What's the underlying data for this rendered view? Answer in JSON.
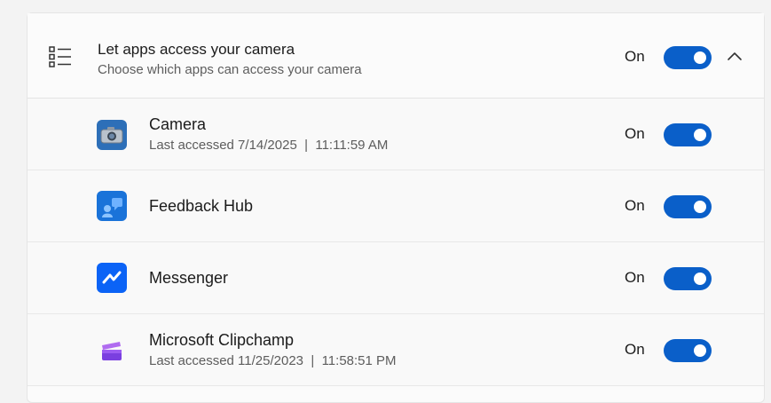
{
  "header": {
    "title": "Let apps access your camera",
    "subtitle": "Choose which apps can access your camera",
    "state_label": "On",
    "toggle_on": true
  },
  "apps": [
    {
      "name": "Camera",
      "last_accessed": "Last accessed 7/14/2025  |  11:11:59 AM",
      "state_label": "On",
      "toggle_on": true,
      "icon": "camera-app-icon"
    },
    {
      "name": "Feedback Hub",
      "last_accessed": "",
      "state_label": "On",
      "toggle_on": true,
      "icon": "feedback-hub-app-icon"
    },
    {
      "name": "Messenger",
      "last_accessed": "",
      "state_label": "On",
      "toggle_on": true,
      "icon": "messenger-app-icon"
    },
    {
      "name": "Microsoft Clipchamp",
      "last_accessed": "Last accessed 11/25/2023  |  11:58:51 PM",
      "state_label": "On",
      "toggle_on": true,
      "icon": "clipchamp-app-icon"
    }
  ],
  "colors": {
    "toggle_on": "#0a5fc9",
    "page_background": "#f3f3f3",
    "panel_background": "#fbfbfb"
  }
}
